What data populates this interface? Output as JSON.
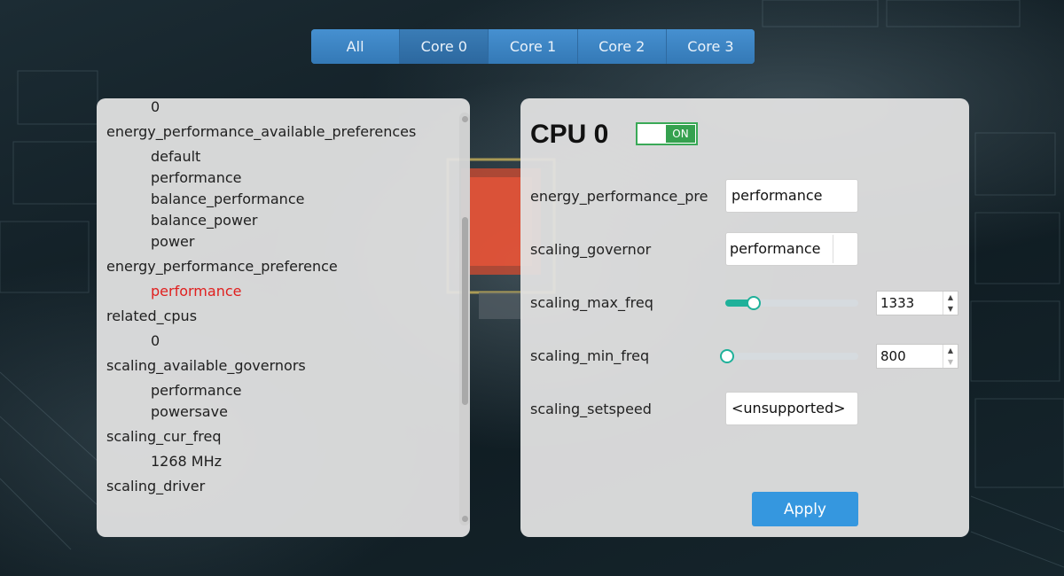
{
  "tabs": [
    {
      "label": "All"
    },
    {
      "label": "Core 0"
    },
    {
      "label": "Core 1"
    },
    {
      "label": "Core 2"
    },
    {
      "label": "Core 3"
    }
  ],
  "active_tab": "Core 0",
  "left_list": [
    {
      "type": "value",
      "text": "0"
    },
    {
      "type": "key",
      "text": "energy_performance_available_preferences"
    },
    {
      "type": "value",
      "text": "default"
    },
    {
      "type": "value",
      "text": "performance"
    },
    {
      "type": "value",
      "text": "balance_performance"
    },
    {
      "type": "value",
      "text": "balance_power"
    },
    {
      "type": "value",
      "text": "power"
    },
    {
      "type": "key",
      "text": "energy_performance_preference"
    },
    {
      "type": "value",
      "text": "performance",
      "highlight": true
    },
    {
      "type": "key",
      "text": "related_cpus"
    },
    {
      "type": "value",
      "text": "0"
    },
    {
      "type": "key",
      "text": "scaling_available_governors"
    },
    {
      "type": "value",
      "text": "performance"
    },
    {
      "type": "value",
      "text": "powersave"
    },
    {
      "type": "key",
      "text": "scaling_cur_freq"
    },
    {
      "type": "value",
      "text": "1268 MHz"
    },
    {
      "type": "key",
      "text": "scaling_driver"
    }
  ],
  "cpu": {
    "title": "CPU 0",
    "toggle_label": "ON",
    "toggle_on": true
  },
  "fields": {
    "epp_label": "energy_performance_preference",
    "epp_value": "performance",
    "governor_label": "scaling_governor",
    "governor_value": "performance",
    "max_freq_label": "scaling_max_freq",
    "max_freq_value": "1333",
    "max_freq_level": 0.2,
    "min_freq_label": "scaling_min_freq",
    "min_freq_value": "800",
    "min_freq_level": 0.0,
    "setspeed_label": "scaling_setspeed",
    "setspeed_value": "<unsupported>"
  },
  "apply_label": "Apply",
  "colors": {
    "accent": "#3597df",
    "toggle_green": "#35a14f",
    "slider_teal": "#1fb19a",
    "highlight_red": "#e0201f"
  }
}
